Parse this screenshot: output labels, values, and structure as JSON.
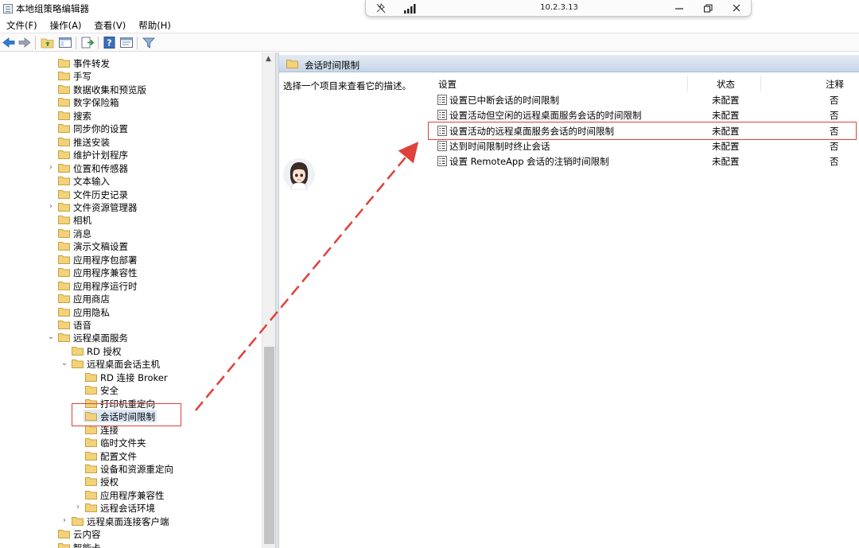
{
  "window": {
    "title": "本地组策略编辑器"
  },
  "remote_session": {
    "ip": "10.2.3.13"
  },
  "menu": [
    "文件(F)",
    "操作(A)",
    "查看(V)",
    "帮助(H)"
  ],
  "tree": [
    {
      "label": "事件转发",
      "expander": ""
    },
    {
      "label": "手写",
      "expander": ""
    },
    {
      "label": "数据收集和预览版",
      "expander": ""
    },
    {
      "label": "数字保险箱",
      "expander": ""
    },
    {
      "label": "搜索",
      "expander": ""
    },
    {
      "label": "同步你的设置",
      "expander": ""
    },
    {
      "label": "推送安装",
      "expander": ""
    },
    {
      "label": "维护计划程序",
      "expander": ""
    },
    {
      "label": "位置和传感器",
      "expander": "›"
    },
    {
      "label": "文本输入",
      "expander": ""
    },
    {
      "label": "文件历史记录",
      "expander": ""
    },
    {
      "label": "文件资源管理器",
      "expander": "›"
    },
    {
      "label": "相机",
      "expander": ""
    },
    {
      "label": "消息",
      "expander": ""
    },
    {
      "label": "演示文稿设置",
      "expander": ""
    },
    {
      "label": "应用程序包部署",
      "expander": ""
    },
    {
      "label": "应用程序兼容性",
      "expander": ""
    },
    {
      "label": "应用程序运行时",
      "expander": ""
    },
    {
      "label": "应用商店",
      "expander": ""
    },
    {
      "label": "应用隐私",
      "expander": ""
    },
    {
      "label": "语音",
      "expander": ""
    },
    {
      "label": "远程桌面服务",
      "expander": "⌄"
    },
    {
      "label": "RD 授权",
      "expander": ""
    },
    {
      "label": "远程桌面会话主机",
      "expander": "⌄"
    },
    {
      "label": "RD 连接 Broker",
      "expander": ""
    },
    {
      "label": "安全",
      "expander": ""
    },
    {
      "label": "打印机重定向",
      "expander": ""
    },
    {
      "label": "会话时间限制",
      "expander": ""
    },
    {
      "label": "连接",
      "expander": ""
    },
    {
      "label": "临时文件夹",
      "expander": ""
    },
    {
      "label": "配置文件",
      "expander": ""
    },
    {
      "label": "设备和资源重定向",
      "expander": ""
    },
    {
      "label": "授权",
      "expander": ""
    },
    {
      "label": "应用程序兼容性",
      "expander": ""
    },
    {
      "label": "远程会话环境",
      "expander": "›"
    },
    {
      "label": "远程桌面连接客户端",
      "expander": "›"
    },
    {
      "label": "云内容",
      "expander": ""
    },
    {
      "label": "智能卡",
      "expander": ""
    }
  ],
  "right_panel": {
    "header": "会话时间限制",
    "description": "选择一个项目来查看它的描述。",
    "columns": {
      "setting": "设置",
      "state": "状态",
      "note": "注释"
    },
    "rows": [
      {
        "name": "设置已中断会话的时间限制",
        "state": "未配置",
        "note": "否"
      },
      {
        "name": "设置活动但空闲的远程桌面服务会话的时间限制",
        "state": "未配置",
        "note": "否"
      },
      {
        "name": "设置活动的远程桌面服务会话的时间限制",
        "state": "未配置",
        "note": "否"
      },
      {
        "name": "达到时间限制时终止会话",
        "state": "未配置",
        "note": "否"
      },
      {
        "name": "设置 RemoteApp 会话的注销时间限制",
        "state": "未配置",
        "note": "否"
      }
    ]
  },
  "colors": {
    "annotation": "#e0403a",
    "folder": "#f2d27a",
    "header": "#c7d6e8"
  }
}
